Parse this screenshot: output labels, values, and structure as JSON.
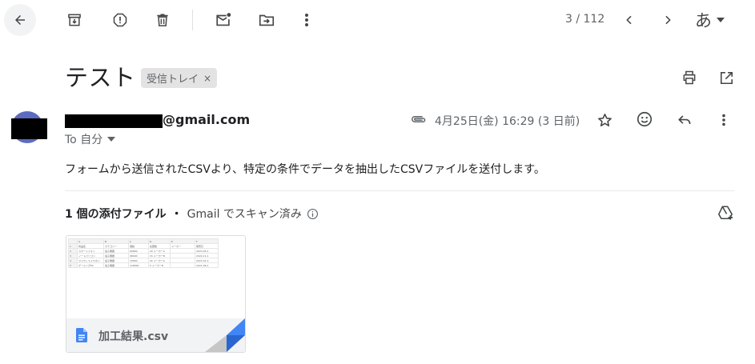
{
  "toolbar": {
    "back_icon": "arrow-left-icon",
    "archive_icon": "archive-icon",
    "spam_icon": "report-spam-icon",
    "delete_icon": "trash-icon",
    "unread_icon": "mark-unread-icon",
    "move_icon": "move-to-icon",
    "more_icon": "more-vert-icon",
    "pagination": "3 / 112",
    "input_method": "あ"
  },
  "message": {
    "subject": "テスト",
    "label": "受信トレイ",
    "label_close": "×",
    "sender_email_suffix": "@gmail.com",
    "recipient": "To 自分",
    "date": "4月25日(金) 16:29 (3 日前)",
    "body": "フォームから送信されたCSVより、特定の条件でデータを抽出したCSVファイルを送付します。"
  },
  "attachments": {
    "heading": "1 個の添付ファイル",
    "separator": "・",
    "scan_note": "Gmail でスキャン済み",
    "file_name": "加工結果.csv",
    "preview_rows": [
      [
        "",
        "A",
        "B",
        "C",
        "D",
        "E",
        "F"
      ],
      [
        "1",
        "商品名",
        "カテゴリー",
        "価格",
        "在庫数",
        "メーカー",
        "発売日"
      ],
      [
        "2",
        "スマートフォン",
        "電子機器",
        "69800",
        "20 メーカーA",
        "",
        "2023-05-1"
      ],
      [
        "3",
        "ノートパソコン",
        "電子機器",
        "98000",
        "15 メーカーB",
        "",
        "2022-11-1"
      ],
      [
        "4",
        "ワイヤレスイヤホン",
        "電子機器",
        "15800",
        "32 メーカーA",
        "",
        "2023-01-2"
      ],
      [
        "5",
        "ゲーミングPC",
        "電子機器",
        "128000",
        "5 メーカーB",
        "",
        "2021-06-1"
      ]
    ]
  },
  "colors": {
    "avatar": "#5c6bc0",
    "label_bg": "#e3e3e3",
    "accent_blue": "#4285f4"
  }
}
